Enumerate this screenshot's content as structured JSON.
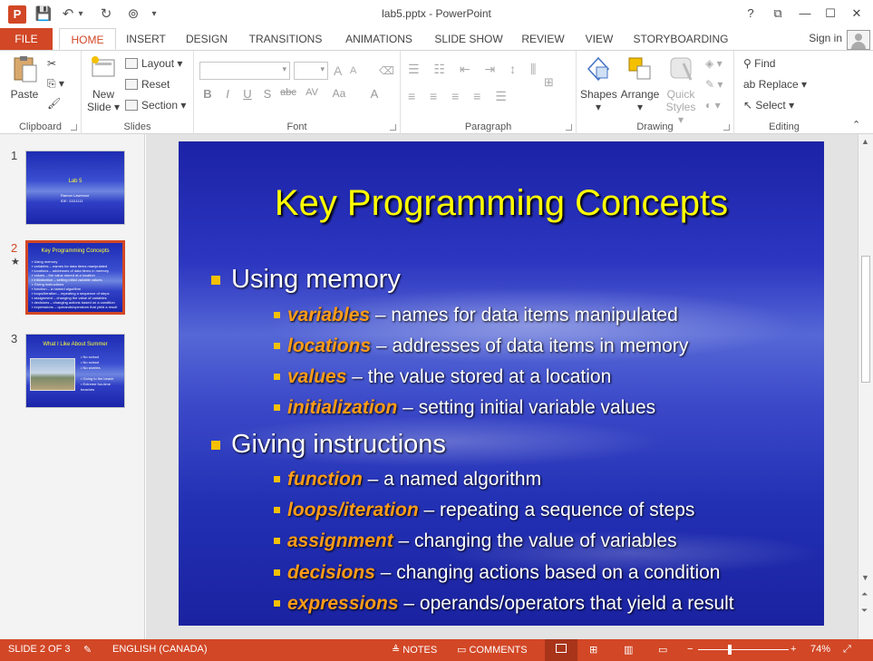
{
  "window": {
    "title": "lab5.pptx - PowerPoint",
    "app_icon": "P",
    "help": "?",
    "restore_ribbon": "⧉",
    "minimize": "—",
    "maximize": "☐",
    "close": "✕"
  },
  "qat": {
    "save": "💾",
    "undo": "↶",
    "undo_drop": "▾",
    "redo": "↻",
    "present": "⊚",
    "customize": "▾"
  },
  "tabs": [
    "FILE",
    "HOME",
    "INSERT",
    "DESIGN",
    "TRANSITIONS",
    "ANIMATIONS",
    "SLIDE SHOW",
    "REVIEW",
    "VIEW",
    "STORYBOARDING"
  ],
  "signin": "Sign in",
  "ribbon": {
    "clipboard": {
      "label": "Clipboard",
      "paste": "Paste"
    },
    "slides": {
      "label": "Slides",
      "new_slide_1": "New",
      "new_slide_2": "Slide",
      "layout": "Layout",
      "reset": "Reset",
      "section": "Section"
    },
    "font": {
      "label": "Font",
      "bold": "B",
      "italic": "I",
      "underline": "U",
      "shadow": "S",
      "strike": "abc",
      "spacing": "AV",
      "case": "Aa",
      "color": "A",
      "grow": "A",
      "shrink": "A"
    },
    "paragraph": {
      "label": "Paragraph"
    },
    "drawing": {
      "label": "Drawing",
      "shapes": "Shapes",
      "arrange": "Arrange",
      "quick_styles_1": "Quick",
      "quick_styles_2": "Styles"
    },
    "editing": {
      "label": "Editing",
      "find": "Find",
      "replace": "Replace",
      "select": "Select"
    }
  },
  "thumbnails": [
    {
      "num": "1",
      "title": "Lab 5",
      "lines": [
        "Ramon Lawrence",
        "IDE: 11111111"
      ]
    },
    {
      "num": "2",
      "title": "Key Programming Concepts",
      "lines": [
        "▪ Using memory",
        "  ▪ variables – names for data items manipulated",
        "  ▪ locations – addresses of data items in memory",
        "  ▪ values – the value stored at a location",
        "  ▪ initialization – setting initial variable values",
        "▪ Giving instructions",
        "  ▪ function – a named algorithm",
        "  ▪ loops/iteration – repeating a sequence of steps",
        "  ▪ assignment – changing the value of variables",
        "  ▪ decisions – changing actions based on a condition",
        "  ▪ expressions – operands/operators that yield a result"
      ]
    },
    {
      "num": "3",
      "title": "What I Like About Summer",
      "lines": [
        "• No school",
        "• No school",
        "• No worries",
        "• Going to the beach",
        "  • Extreme fun-time",
        "    beaches"
      ]
    }
  ],
  "star": "★",
  "slide": {
    "title": "Key Programming Concepts",
    "sections": [
      {
        "heading": "Using memory",
        "items": [
          {
            "term": "variables",
            "desc": " – names for data items manipulated"
          },
          {
            "term": "locations",
            "desc": " – addresses of data items in memory"
          },
          {
            "term": "values",
            "desc": " – the value stored at a location"
          },
          {
            "term": "initialization",
            "desc": " – setting initial variable values"
          }
        ]
      },
      {
        "heading": "Giving instructions",
        "items": [
          {
            "term": "function",
            "desc": " – a named algorithm"
          },
          {
            "term": "loops/iteration",
            "desc": " – repeating a sequence of steps"
          },
          {
            "term": "assignment",
            "desc": " – changing the value of variables"
          },
          {
            "term": "decisions",
            "desc": " – changing actions based on a condition"
          },
          {
            "term": "expressions",
            "desc": " – operands/operators that yield a result"
          }
        ]
      }
    ]
  },
  "status": {
    "slide_info": "SLIDE 2 OF 3",
    "language": "ENGLISH (CANADA)",
    "notes": "NOTES",
    "comments": "COMMENTS",
    "zoom_minus": "−",
    "zoom_plus": "+",
    "zoom": "74%"
  },
  "colors": {
    "accent": "#d24726",
    "title_yellow": "#ffff00",
    "term_orange": "#ff9c18",
    "bullet": "#f5c000"
  }
}
